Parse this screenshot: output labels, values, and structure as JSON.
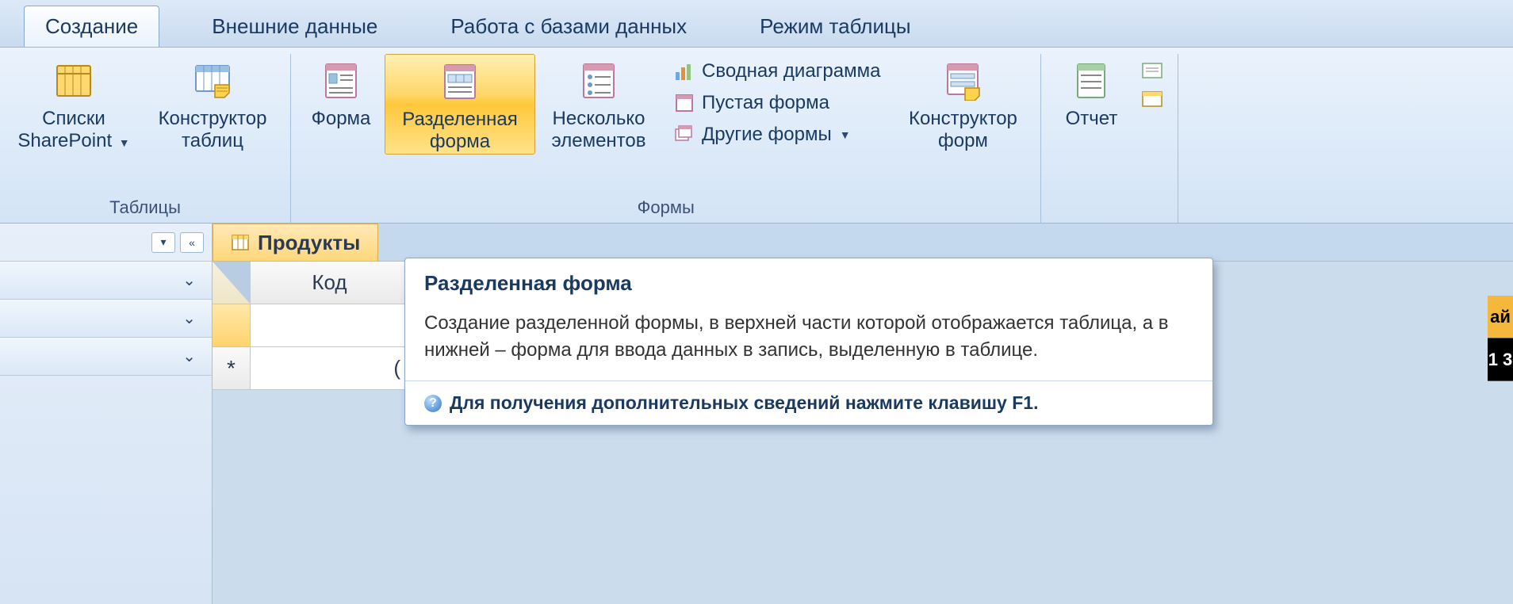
{
  "tabs": {
    "create": "Создание",
    "external": "Внешние данные",
    "dbtools": "Работа с базами данных",
    "tablemode": "Режим таблицы"
  },
  "groups": {
    "tables": {
      "label": "Таблицы"
    },
    "forms": {
      "label": "Формы"
    }
  },
  "buttons": {
    "sharepoint": "Списки SharePoint",
    "table_designer": "Конструктор таблиц",
    "form": "Форма",
    "split_form": "Разделенная форма",
    "multiple_items": "Несколько элементов",
    "pivot_chart": "Сводная диаграмма",
    "blank_form": "Пустая форма",
    "more_forms": "Другие формы",
    "form_designer": "Конструктор форм",
    "report": "Отчет"
  },
  "document": {
    "tab_name": "Продукты",
    "column_header": "Код",
    "new_row_marker": "*",
    "paren": "("
  },
  "tooltip": {
    "title": "Разделенная форма",
    "body": "Создание разделенной формы, в верхней части которой отображается таблица, а в нижней – форма для ввода данных в запись, выделенную в таблице.",
    "f1": "Для получения дополнительных сведений нажмите клавишу F1."
  },
  "peek": {
    "row1": "ай",
    "row2": "1 3"
  }
}
